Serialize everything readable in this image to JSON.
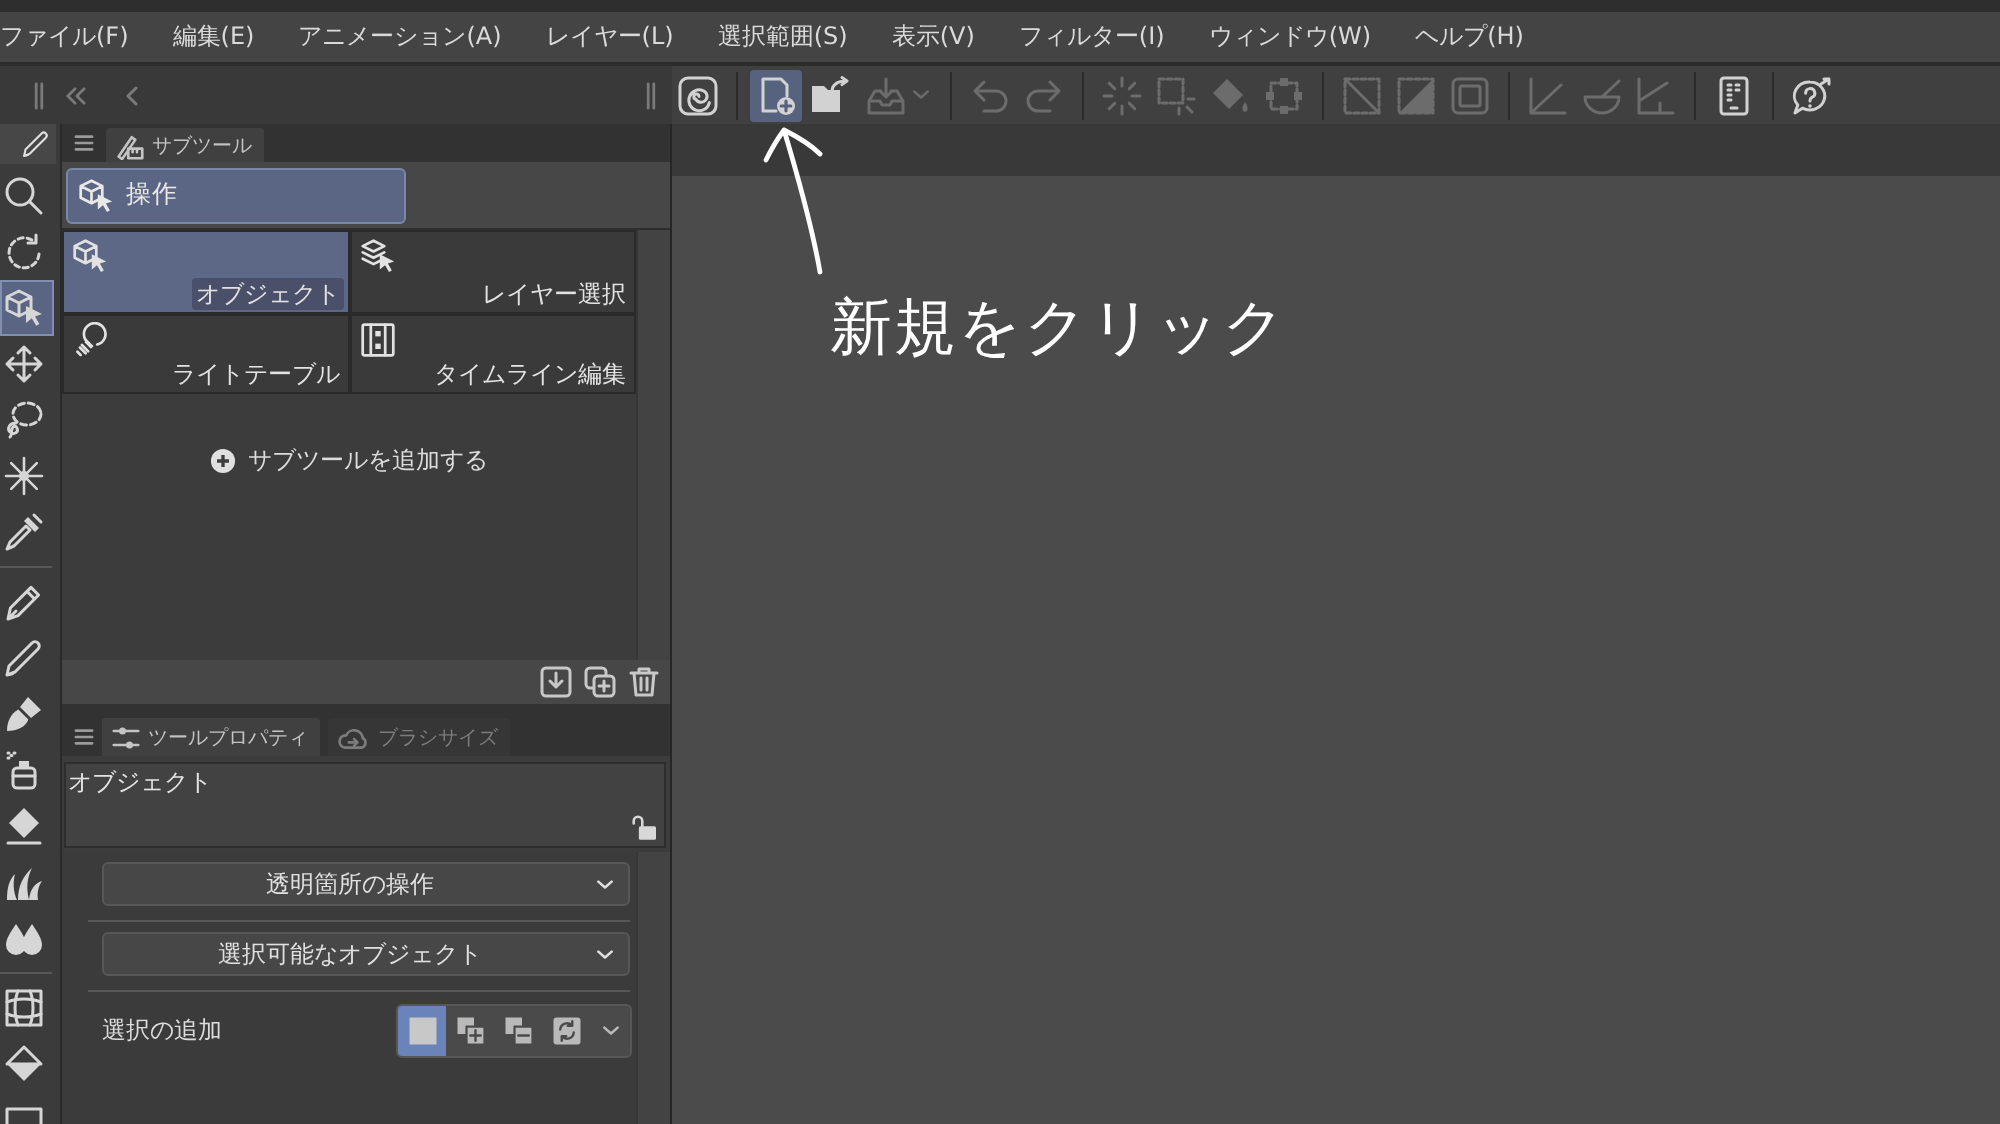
{
  "menu": [
    "ファイル(F)",
    "編集(E)",
    "アニメーション(A)",
    "レイヤー(L)",
    "選択範囲(S)",
    "表示(V)",
    "フィルター(I)",
    "ウィンドウ(W)",
    "ヘルプ(H)"
  ],
  "toolbar": {
    "groups": [
      [
        {
          "kind": "logo",
          "disabled": false,
          "highlighted": false
        }
      ],
      [
        {
          "kind": "new",
          "disabled": false,
          "highlighted": true
        },
        {
          "kind": "open",
          "disabled": false,
          "highlighted": false
        },
        {
          "kind": "export",
          "disabled": true,
          "highlighted": false
        }
      ],
      [
        {
          "kind": "undo",
          "disabled": true,
          "highlighted": false
        },
        {
          "kind": "redo",
          "disabled": true,
          "highlighted": false
        }
      ],
      [
        {
          "kind": "burst",
          "disabled": true,
          "highlighted": false
        },
        {
          "kind": "marquee",
          "disabled": true,
          "highlighted": false
        },
        {
          "kind": "bucket",
          "disabled": true,
          "highlighted": false
        },
        {
          "kind": "crop",
          "disabled": true,
          "highlighted": false
        }
      ],
      [
        {
          "kind": "clear",
          "disabled": true,
          "highlighted": false
        },
        {
          "kind": "invert",
          "disabled": true,
          "highlighted": false
        },
        {
          "kind": "frame",
          "disabled": true,
          "highlighted": false
        }
      ],
      [
        {
          "kind": "ruler",
          "disabled": true,
          "highlighted": false
        },
        {
          "kind": "curve",
          "disabled": true,
          "highlighted": false
        },
        {
          "kind": "angle",
          "disabled": true,
          "highlighted": false
        }
      ],
      [
        {
          "kind": "device",
          "disabled": false,
          "highlighted": false
        }
      ],
      [
        {
          "kind": "help",
          "disabled": false,
          "highlighted": false
        }
      ]
    ]
  },
  "tools": {
    "groups": [
      [
        {
          "kind": "zoom",
          "selected": false
        },
        {
          "kind": "rotate",
          "selected": false
        },
        {
          "kind": "object",
          "selected": true
        },
        {
          "kind": "move",
          "selected": false
        },
        {
          "kind": "lasso",
          "selected": false
        },
        {
          "kind": "wand",
          "selected": false
        },
        {
          "kind": "dropper",
          "selected": false
        }
      ],
      [
        {
          "kind": "pen",
          "selected": false
        },
        {
          "kind": "pencil",
          "selected": false
        },
        {
          "kind": "brush",
          "selected": false
        },
        {
          "kind": "spray",
          "selected": false
        },
        {
          "kind": "eraser",
          "selected": false
        },
        {
          "kind": "grass",
          "selected": false
        },
        {
          "kind": "blend",
          "selected": false
        }
      ],
      [
        {
          "kind": "grid",
          "selected": false
        },
        {
          "kind": "fill",
          "selected": false
        },
        {
          "kind": "box",
          "selected": false
        }
      ]
    ]
  },
  "subtool_panel": {
    "tab": "サブツール",
    "group": {
      "label": "操作",
      "selected": true
    },
    "items": [
      {
        "kind": "object",
        "label": "オブジェクト",
        "selected": true
      },
      {
        "kind": "layer",
        "label": "レイヤー選択",
        "selected": false
      },
      {
        "kind": "light",
        "label": "ライトテーブル",
        "selected": false
      },
      {
        "kind": "timeline",
        "label": "タイムライン編集",
        "selected": false
      }
    ],
    "add_label": "サブツールを追加する"
  },
  "tool_property": {
    "tabs": [
      {
        "label": "ツールプロパティ",
        "selected": true
      },
      {
        "label": "ブラシサイズ",
        "selected": false
      }
    ],
    "title": "オブジェクト",
    "locked": false,
    "dropdowns": [
      "透明箇所の操作",
      "選択可能なオブジェクト"
    ],
    "selection_add": {
      "label": "選択の追加",
      "modes": [
        {
          "kind": "new",
          "selected": true
        },
        {
          "kind": "add",
          "selected": false
        },
        {
          "kind": "subtract",
          "selected": false
        },
        {
          "kind": "toggle",
          "selected": false
        }
      ]
    }
  },
  "annotation": {
    "text": "新規をクリック"
  }
}
